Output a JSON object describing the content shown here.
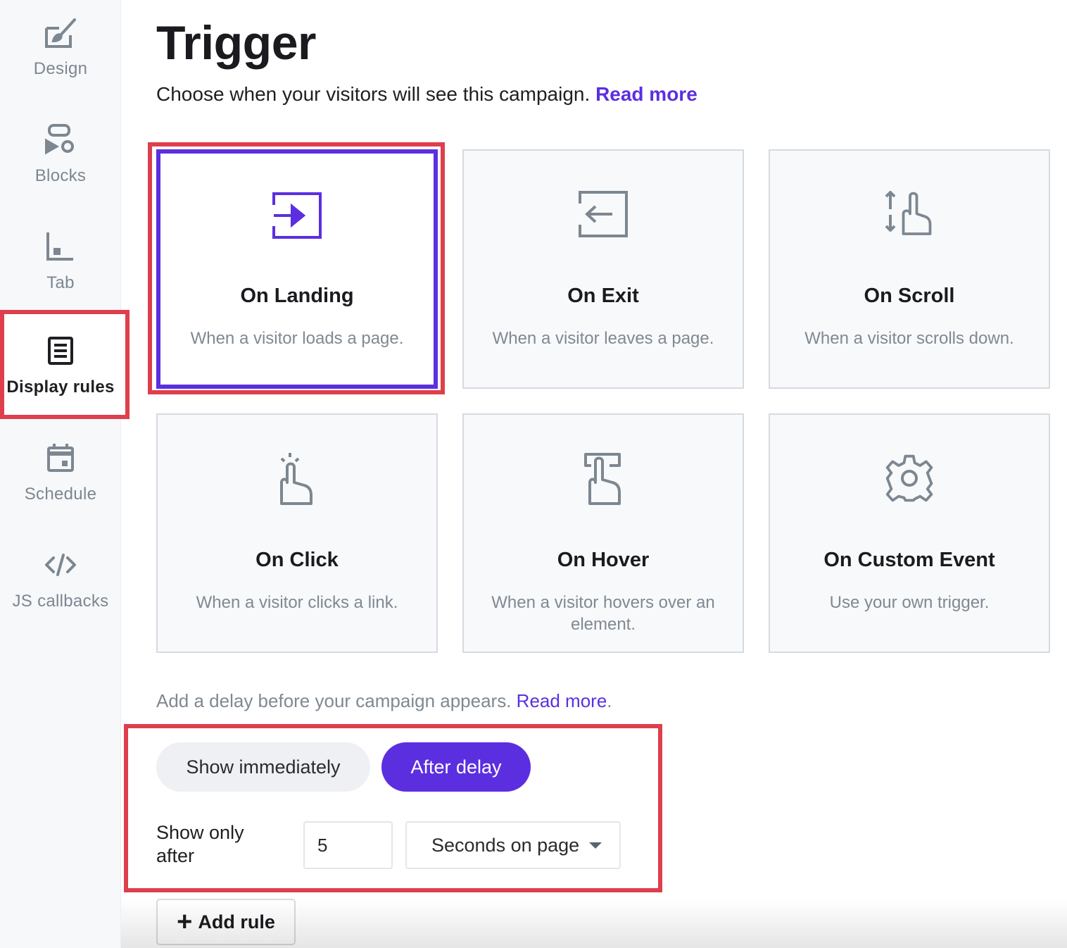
{
  "sidebar": {
    "items": [
      {
        "label": "Design",
        "icon": "design-icon"
      },
      {
        "label": "Blocks",
        "icon": "blocks-icon"
      },
      {
        "label": "Tab",
        "icon": "tab-icon"
      },
      {
        "label": "Display rules",
        "icon": "display-rules-icon",
        "active": true
      },
      {
        "label": "Schedule",
        "icon": "calendar-icon"
      },
      {
        "label": "JS callbacks",
        "icon": "code-icon"
      }
    ]
  },
  "header": {
    "title": "Trigger",
    "subtitle": "Choose when your visitors will see this campaign.",
    "read_more": "Read more"
  },
  "triggers": [
    {
      "title": "On Landing",
      "desc": "When a visitor loads a page.",
      "icon": "enter-icon",
      "selected": true
    },
    {
      "title": "On Exit",
      "desc": "When a visitor leaves a page.",
      "icon": "exit-icon"
    },
    {
      "title": "On Scroll",
      "desc": "When a visitor scrolls down.",
      "icon": "scroll-hand-icon"
    },
    {
      "title": "On Click",
      "desc": "When a visitor clicks a link.",
      "icon": "click-hand-icon"
    },
    {
      "title": "On Hover",
      "desc": "When a visitor hovers over an element.",
      "icon": "hover-hand-icon"
    },
    {
      "title": "On Custom Event",
      "desc": "Use your own trigger.",
      "icon": "gear-icon"
    }
  ],
  "delay": {
    "text": "Add a delay before your campaign appears.",
    "read_more": "Read more",
    "period": ".",
    "show_immediately": "Show immediately",
    "after_delay": "After delay",
    "selected": "After delay",
    "show_only_after_line1": "Show only",
    "show_only_after_line2": "after",
    "amount": "5",
    "unit": "Seconds on page"
  },
  "add_rule": {
    "label": "Add rule",
    "plus": "+"
  },
  "colors": {
    "accent": "#5b2fe0",
    "highlight": "#de3f4d",
    "muted": "#7f8992"
  }
}
